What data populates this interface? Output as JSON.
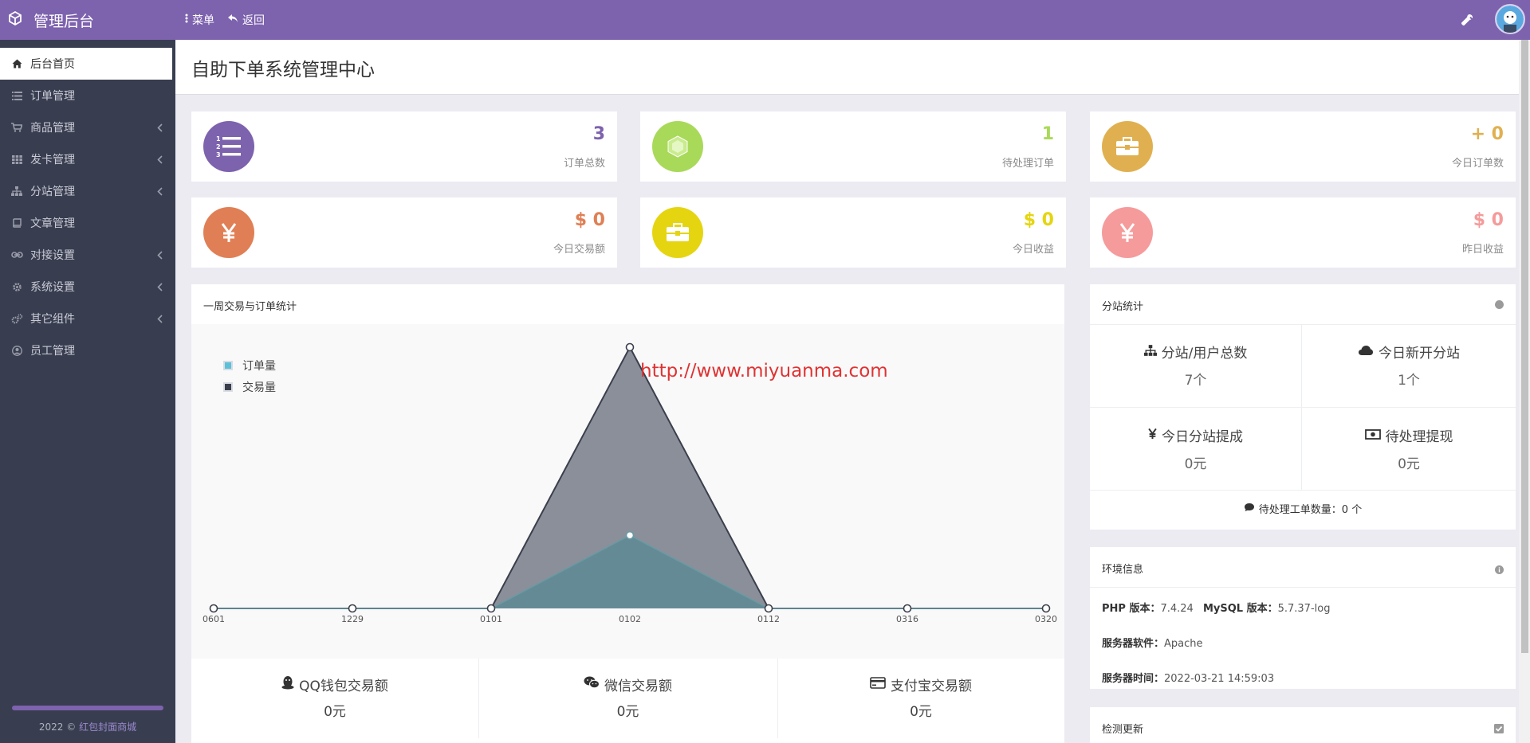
{
  "app": {
    "title": "管理后台"
  },
  "topnav": {
    "menu_label": "菜单",
    "back_label": "返回"
  },
  "sidebar": {
    "items": [
      {
        "label": "后台首页",
        "icon": "home-icon",
        "active": true,
        "has_caret": false
      },
      {
        "label": "订单管理",
        "icon": "list-icon",
        "active": false,
        "has_caret": false
      },
      {
        "label": "商品管理",
        "icon": "cart-icon",
        "active": false,
        "has_caret": true
      },
      {
        "label": "发卡管理",
        "icon": "grid-icon",
        "active": false,
        "has_caret": true
      },
      {
        "label": "分站管理",
        "icon": "sitemap-icon",
        "active": false,
        "has_caret": true
      },
      {
        "label": "文章管理",
        "icon": "book-icon",
        "active": false,
        "has_caret": false
      },
      {
        "label": "对接设置",
        "icon": "link-icon",
        "active": false,
        "has_caret": true
      },
      {
        "label": "系统设置",
        "icon": "gear-icon",
        "active": false,
        "has_caret": true
      },
      {
        "label": "其它组件",
        "icon": "cogs-icon",
        "active": false,
        "has_caret": true
      },
      {
        "label": "员工管理",
        "icon": "user-icon",
        "active": false,
        "has_caret": false
      }
    ],
    "footer": {
      "year": "2022 ©",
      "link": "红包封面商城"
    }
  },
  "page": {
    "title": "自助下单系统管理中心"
  },
  "stats": [
    {
      "value": "3",
      "label": "订单总数",
      "color": "#7d62ae",
      "icon": "ordered-list-icon"
    },
    {
      "value": "1",
      "label": "待处理订单",
      "color": "#a9d959",
      "icon": "cube-icon"
    },
    {
      "value": "+ 0",
      "label": "今日订单数",
      "color": "#e0b050",
      "icon": "briefcase-icon"
    },
    {
      "value": "$ 0",
      "label": "今日交易额",
      "color": "#e07f55",
      "icon": "yen-icon"
    },
    {
      "value": "$ 0",
      "label": "今日收益",
      "color": "#e5d510",
      "icon": "briefcase-icon"
    },
    {
      "value": "$ 0",
      "label": "昨日收益",
      "color": "#f59b9b",
      "icon": "yen-icon"
    }
  ],
  "chart_panel": {
    "title": "一周交易与订单统计",
    "watermark": "http://www.miyuanma.com"
  },
  "chart_data": {
    "type": "area",
    "categories": [
      "0601",
      "1229",
      "0101",
      "0102",
      "0112",
      "0316",
      "0320"
    ],
    "series": [
      {
        "name": "订单量",
        "values": [
          0,
          0,
          0,
          2.8,
          0,
          0,
          0
        ],
        "color": "#5f8b95"
      },
      {
        "name": "交易量",
        "values": [
          0,
          0,
          0,
          10,
          0,
          0,
          0
        ],
        "color": "#8a8f99"
      }
    ],
    "ylim": [
      0,
      10
    ],
    "legend": "top-left",
    "grid": false
  },
  "payments": [
    {
      "label": "QQ钱包交易额",
      "value": "0元",
      "icon": "qq-icon"
    },
    {
      "label": "微信交易额",
      "value": "0元",
      "icon": "wechat-icon"
    },
    {
      "label": "支付宝交易额",
      "value": "0元",
      "icon": "credit-card-icon"
    }
  ],
  "branch_panel": {
    "title": "分站统计",
    "cells": [
      {
        "label": "分站/用户总数",
        "value": "7个",
        "icon": "sitemap-icon"
      },
      {
        "label": "今日新开分站",
        "value": "1个",
        "icon": "cloud-icon"
      },
      {
        "label": "今日分站提成",
        "value": "0元",
        "icon": "yen-icon"
      },
      {
        "label": "待处理提现",
        "value": "0元",
        "icon": "money-icon"
      }
    ],
    "ticket_label": "待处理工单数量：",
    "ticket_value": "0 个"
  },
  "env_panel": {
    "title": "环境信息",
    "php_label": "PHP 版本：",
    "php_value": "7.4.24",
    "mysql_label": "MySQL 版本：",
    "mysql_value": "5.7.37-log",
    "server_label": "服务器软件：",
    "server_value": "Apache",
    "time_label": "服务器时间：",
    "time_value": "2022-03-21 14:59:03"
  },
  "update_panel": {
    "title": "检测更新"
  }
}
